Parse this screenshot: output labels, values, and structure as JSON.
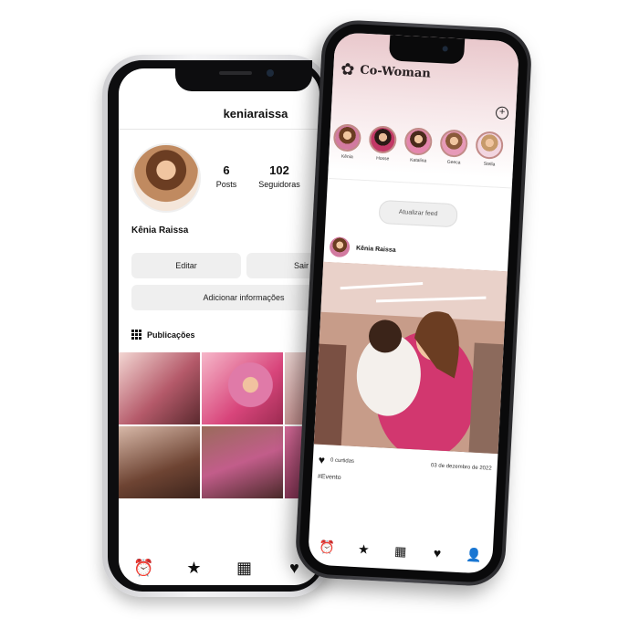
{
  "left_app": {
    "username": "keniaraissa",
    "profile_name": "Kênia Raissa",
    "stats": [
      {
        "value": "6",
        "label": "Posts"
      },
      {
        "value": "102",
        "label": "Seguidoras"
      }
    ],
    "buttons": {
      "edit": "Editar",
      "exit": "Sair",
      "add_info": "Adicionar informações"
    },
    "section_label": "Publicações",
    "tab_icons": [
      "alarm-clock-icon",
      "star-icon",
      "grid-icon",
      "heart-icon"
    ]
  },
  "right_app": {
    "brand": "Co-Woman",
    "stories": [
      {
        "name": "Kênia"
      },
      {
        "name": "Hosse"
      },
      {
        "name": "Katalina"
      },
      {
        "name": "Geeca"
      },
      {
        "name": "Stella"
      }
    ],
    "update_button": "Atualizar feed",
    "post": {
      "author": "Kênia Raissa",
      "likes": "0 curtidas",
      "date": "03 de dezembro de 2022",
      "tag": "#Evento"
    },
    "tab_icons": [
      "alarm-clock-icon",
      "star-icon",
      "grid-icon",
      "heart-icon",
      "profile-icon"
    ]
  },
  "colors": {
    "accent_pink": "#d6457e",
    "header_pink": "#e9c8cc"
  }
}
